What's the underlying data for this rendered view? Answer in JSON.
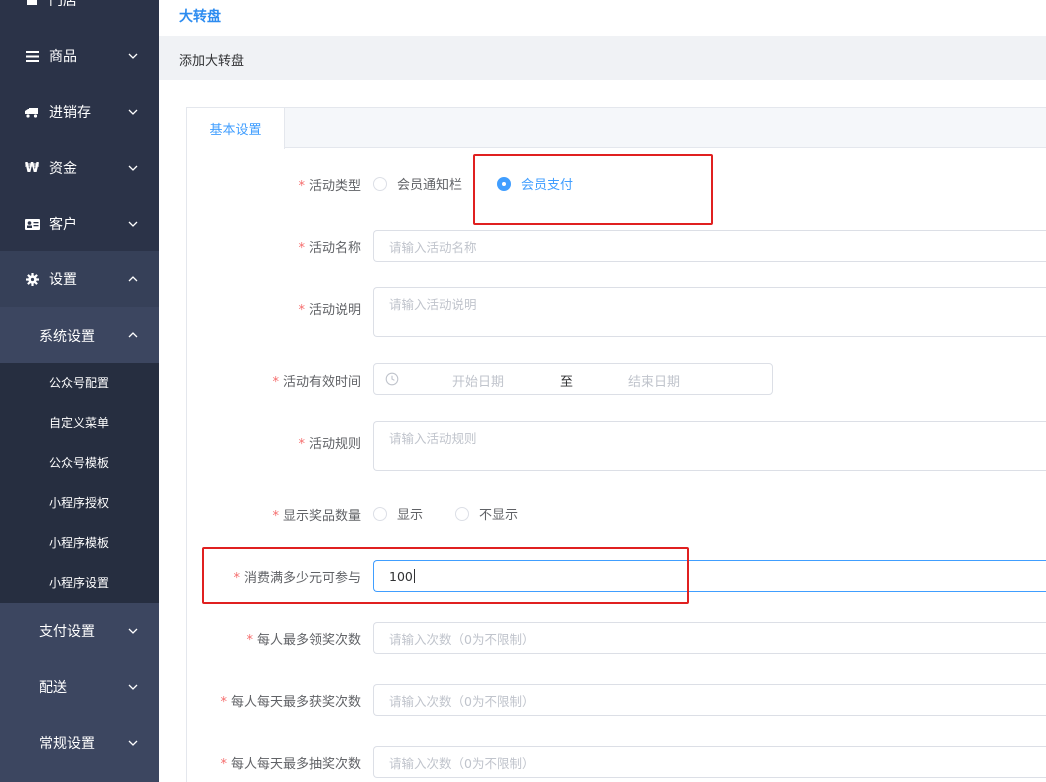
{
  "sidebar": {
    "items": [
      {
        "label": "门店",
        "icon": "store-icon"
      },
      {
        "label": "商品",
        "icon": "list-icon"
      },
      {
        "label": "进销存",
        "icon": "truck-icon"
      },
      {
        "label": "资金",
        "icon": "won-icon"
      },
      {
        "label": "客户",
        "icon": "id-card-icon"
      },
      {
        "label": "设置",
        "icon": "gear-icon"
      }
    ],
    "system_group": {
      "label": "系统设置"
    },
    "sub_items": [
      "公众号配置",
      "自定义菜单",
      "公众号模板",
      "小程序授权",
      "小程序模板",
      "小程序设置"
    ],
    "lower_items": [
      {
        "label": "支付设置"
      },
      {
        "label": "配送"
      },
      {
        "label": "常规设置"
      }
    ]
  },
  "header": {
    "title": "大转盘",
    "breadcrumb": "添加大转盘"
  },
  "tabs": {
    "active": "基本设置"
  },
  "form": {
    "type_label": "活动类型",
    "type_options": [
      "会员通知栏",
      "会员支付"
    ],
    "name_label": "活动名称",
    "name_placeholder": "请输入活动名称",
    "desc_label": "活动说明",
    "desc_placeholder": "请输入活动说明",
    "time_label": "活动有效时间",
    "time_start": "开始日期",
    "time_sep": "至",
    "time_end": "结束日期",
    "rules_label": "活动规则",
    "rules_placeholder": "请输入活动规则",
    "show_label": "显示奖品数量",
    "show_options": [
      "显示",
      "不显示"
    ],
    "min_spend_label": "消费满多少元可参与",
    "min_spend_value": "100",
    "per_person_label": "每人最多领奖次数",
    "per_person_placeholder": "请输入次数（0为不限制）",
    "daily_win_label": "每人每天最多获奖次数",
    "daily_win_placeholder": "请输入次数（0为不限制）",
    "daily_draw_label": "每人每天最多抽奖次数",
    "daily_draw_placeholder": "请输入次数（0为不限制）",
    "required_mark": "*"
  },
  "colors": {
    "sidebar_bg": "#2b3348",
    "accent": "#409eff",
    "required": "#f56c6c",
    "highlight": "#e02020"
  }
}
